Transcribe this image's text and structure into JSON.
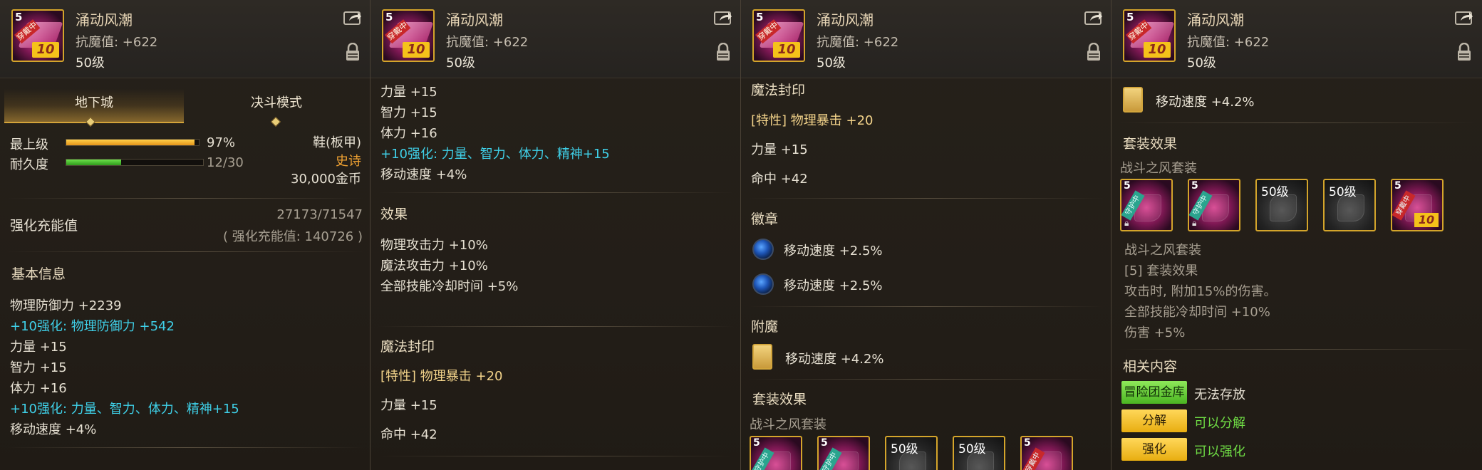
{
  "item": {
    "name": "涌动风潮",
    "magic_resist": "抗魔值: +622",
    "level": "50级",
    "icon_grade": "5",
    "icon_wear_tag": "穿戴中",
    "icon_reinforce": "10"
  },
  "panel1": {
    "tabs": [
      "地下城",
      "决斗模式"
    ],
    "rows": [
      {
        "label": "最上级",
        "value": "97%",
        "fill": 0.97
      },
      {
        "label": "耐久度",
        "value": "12/30",
        "fill": 0.4
      }
    ],
    "type": "鞋(板甲)",
    "rarity": "史诗",
    "price": "30,000金币",
    "charge_label": "强化充能值",
    "charge_value": "27173/71547",
    "charge_total": "( 强化充能值: 140726 )",
    "basic_title": "基本信息",
    "lines": [
      "物理防御力 +2239",
      "+10强化: 物理防御力 +542",
      "力量 +15",
      "智力 +15",
      "体力 +16",
      "+10强化: 力量、智力、体力、精神+15",
      "移动速度 +4%"
    ]
  },
  "panel2": {
    "top_lines": [
      "力量 +15",
      "智力 +15",
      "体力 +16",
      "+10强化: 力量、智力、体力、精神+15",
      "移动速度 +4%"
    ],
    "effect_title": "效果",
    "effect_lines": [
      "物理攻击力 +10%",
      "魔法攻击力 +10%",
      "全部技能冷却时间 +5%"
    ],
    "seal_title": "魔法封印",
    "seal_lines": [
      "[特性] 物理暴击 +20",
      "力量 +15",
      "命中 +42"
    ]
  },
  "panel3": {
    "seal_title": "魔法封印",
    "seal_lines": [
      "[特性] 物理暴击 +20",
      "力量 +15",
      "命中 +42"
    ],
    "emblem_title": "徽章",
    "emblem_lines": [
      "移动速度 +2.5%",
      "移动速度 +2.5%"
    ],
    "enchant_title": "附魔",
    "enchant_line": "移动速度 +4.2%",
    "set_title": "套装效果",
    "set_name": "战斗之风套装",
    "slots": [
      {
        "tag": "守护中",
        "grade": "5"
      },
      {
        "tag": "守护中",
        "grade": "5"
      },
      {
        "lvl": "50级"
      },
      {
        "lvl": "50级"
      },
      {
        "tag": "穿戴中",
        "grade": "5"
      }
    ]
  },
  "panel4": {
    "enchant_line": "移动速度 +4.2%",
    "set_title": "套装效果",
    "set_name": "战斗之风套装",
    "slots": [
      {
        "tag": "守护中",
        "grade": "5"
      },
      {
        "tag": "守护中",
        "grade": "5"
      },
      {
        "lvl": "50级"
      },
      {
        "lvl": "50级"
      },
      {
        "tag": "穿戴中",
        "grade": "5",
        "ten": "10"
      }
    ],
    "set_lines": [
      "战斗之风套装",
      "[5] 套装效果",
      "攻击时, 附加15%的伤害。",
      "全部技能冷却时间 +10%",
      "伤害 +5%"
    ],
    "related_title": "相关内容",
    "related": [
      {
        "button": "冒险团金库",
        "status": "无法存放"
      },
      {
        "button": "分解",
        "status": "可以分解"
      },
      {
        "button": "强化",
        "status": "可以强化"
      }
    ]
  }
}
